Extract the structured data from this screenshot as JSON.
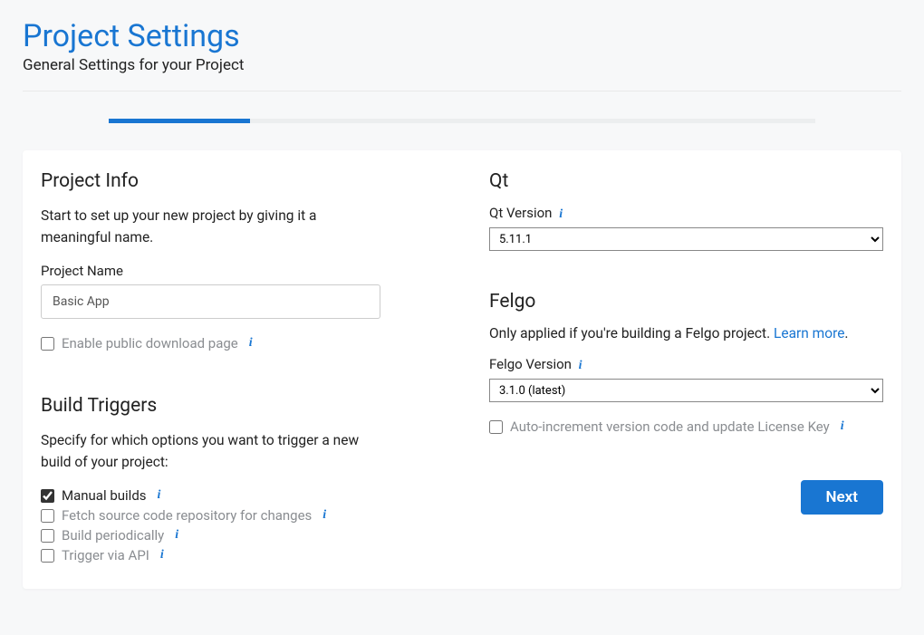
{
  "header": {
    "title": "Project Settings",
    "subtitle": "General Settings for your Project"
  },
  "progress": {
    "percent": 20
  },
  "project_info": {
    "title": "Project Info",
    "desc": "Start to set up your new project by giving it a meaningful name.",
    "name_label": "Project Name",
    "name_value": "Basic App",
    "public_download_label": "Enable public download page",
    "public_download_checked": false
  },
  "build_triggers": {
    "title": "Build Triggers",
    "desc": "Specify for which options you want to trigger a new build of your project:",
    "items": [
      {
        "label": "Manual builds",
        "checked": true
      },
      {
        "label": "Fetch source code repository for changes",
        "checked": false
      },
      {
        "label": "Build periodically",
        "checked": false
      },
      {
        "label": "Trigger via API",
        "checked": false
      }
    ]
  },
  "qt": {
    "title": "Qt",
    "version_label": "Qt Version",
    "version_value": "5.11.1"
  },
  "felgo": {
    "title": "Felgo",
    "note_prefix": "Only applied if you're building a Felgo project. ",
    "learn_more": "Learn more",
    "note_suffix": ".",
    "version_label": "Felgo Version",
    "version_value": "3.1.0 (latest)",
    "auto_increment_label": "Auto-increment version code and update License Key",
    "auto_increment_checked": false
  },
  "footer": {
    "next": "Next"
  }
}
